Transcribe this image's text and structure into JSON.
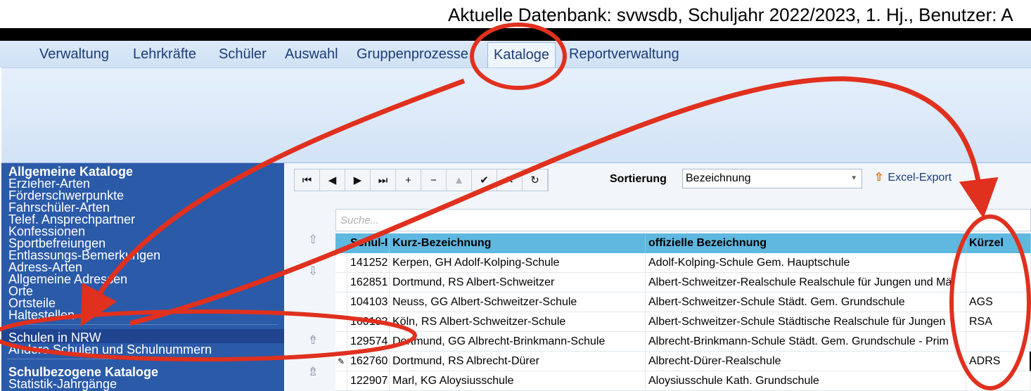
{
  "window": {
    "title": "Aktuelle Datenbank: svwsdb, Schuljahr 2022/2023, 1. Hj., Benutzer: A"
  },
  "menu": {
    "items": [
      "Verwaltung",
      "Lehrkräfte",
      "Schüler",
      "Auswahl",
      "Gruppenprozesse",
      "Kataloge",
      "Reportverwaltung"
    ],
    "active": "Kataloge"
  },
  "sidebar": {
    "section1": "Allgemeine Kataloge",
    "items1": [
      "Erzieher-Arten",
      "Förderschwerpunkte",
      "Fahrschüler-Arten",
      "Telef. Ansprechpartner",
      "Konfessionen",
      "Sportbefreiungen",
      "Entlassungs-Bemerkungen",
      "Adress-Arten",
      "Allgemeine Adressen",
      "Orte",
      "Ortsteile",
      "Haltestellen"
    ],
    "selected": "Schulen in NRW",
    "other": "Andere Schulen und Schulnummern",
    "section2": "Schulbezogene Kataloge",
    "items2": [
      "Statistik-Jahrgänge"
    ]
  },
  "toolbar": {
    "nav_buttons": [
      "⏮",
      "◀",
      "▶",
      "⏭",
      "+",
      "−",
      "▲",
      "✔",
      "✕",
      "↻"
    ],
    "sort_label": "Sortierung",
    "sort_value": "Bezeichnung",
    "excel_export": "Excel-Export",
    "excel_icon": "upload-arrow-icon"
  },
  "search": {
    "placeholder": "Suche..."
  },
  "table": {
    "columns": [
      "Schul-I",
      "Kurz-Bezeichnung",
      "offizielle Bezeichnung",
      "Kürzel"
    ],
    "rows": [
      [
        "141252",
        "Kerpen, GH Adolf-Kolping-Schule",
        "Adolf-Kolping-Schule Gem. Hauptschule",
        ""
      ],
      [
        "162851",
        "Dortmund, RS Albert-Schweitzer",
        "Albert-Schweitzer-Realschule Realschule für Jungen und Mä",
        ""
      ],
      [
        "104103",
        "Neuss, GG Albert-Schweitzer-Schule",
        "Albert-Schweitzer-Schule Städt. Gem. Grundschule",
        "AGS"
      ],
      [
        "160192",
        "Köln, RS Albert-Schweitzer-Schule",
        "Albert-Schweitzer-Schule Städtische Realschule für Jungen",
        "RSA"
      ],
      [
        "129574",
        "Dortmund, GG Albrecht-Brinkmann-Schule",
        "Albrecht-Brinkmann-Schule Städt. Gem. Grundschule - Prim",
        ""
      ],
      [
        "162760",
        "Dortmund, RS Albrecht-Dürer",
        "Albrecht-Dürer-Realschule",
        "ADRS"
      ],
      [
        "122907",
        "Marl, KG Aloysiusschule",
        "Aloysiusschule Kath. Grundschule",
        ""
      ]
    ],
    "editing_row": 5
  },
  "colors": {
    "sidebar": "#2b5aa8",
    "header": "#5fb8e0",
    "annotation": "#e0301e",
    "menu_text": "#1c3c78"
  }
}
